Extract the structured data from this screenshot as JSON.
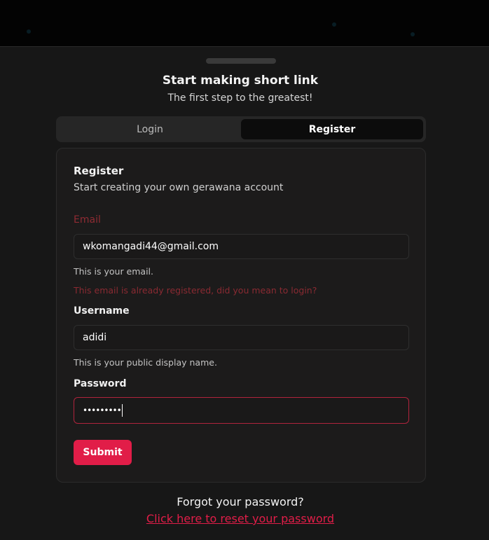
{
  "header": {
    "title": "Start making short link",
    "subtitle": "The first step to the greatest!"
  },
  "tabs": [
    {
      "label": "Login",
      "active": false
    },
    {
      "label": "Register",
      "active": true
    }
  ],
  "form": {
    "title": "Register",
    "description": "Start creating your own gerawana account",
    "email": {
      "label": "Email",
      "value": "wkomangadi44@gmail.com",
      "help": "This is your email.",
      "error": "This email is already registered, did you mean to login?"
    },
    "username": {
      "label": "Username",
      "value": "adidi",
      "help": "This is your public display name."
    },
    "password": {
      "label": "Password",
      "value": "•••••••••"
    },
    "submit_label": "Submit"
  },
  "footer": {
    "forgot_text": "Forgot your password?",
    "reset_link": "Click here to reset your password"
  },
  "colors": {
    "accent": "#e11d48",
    "error": "#8f2b33",
    "background": "#171717"
  }
}
